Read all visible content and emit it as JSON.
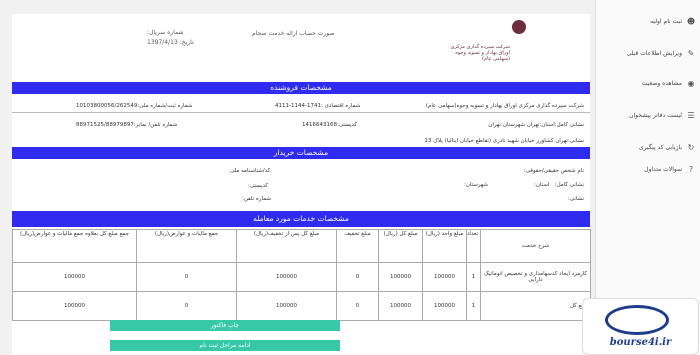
{
  "sidebar": {
    "items": [
      {
        "label": "ثبت نام اولیه",
        "icon": "user-icon"
      },
      {
        "label": "ویرایش اطلاعات قبلی",
        "icon": "edit-icon"
      },
      {
        "label": "مشاهده وضعیت",
        "icon": "eye-icon"
      },
      {
        "label": "لیست دفاتر پیشخوان",
        "icon": "list-icon"
      },
      {
        "label": "بازیابی کد پیگیری",
        "icon": "refresh-icon"
      },
      {
        "label": "سوالات متداول",
        "icon": "question-icon"
      }
    ]
  },
  "header": {
    "company_name": "شرکت سپرده گذاری مرکزی اوراق بهادار و تسویه وجوه (سهامی عام)",
    "invoice_title": "صورت حساب ارائه خدمت سجام",
    "serial_label": "شماره سریال:",
    "serial_value": "",
    "date_label": "تاریخ:",
    "date_value": "1397/4/13"
  },
  "seller": {
    "section_title": "مشخصات فروشنده",
    "name": "شرکت سپرده گذاری مرکزی اوراق بهادار و تسویه وجوه(سهامی عام)",
    "economic_no": "شماره اقتصادی :1741-1144-4111",
    "national_id": "شماره ثبت/شماره ملی:10103800056/262549",
    "full_address": "نشانی کامل:استان:تهران شهرستان:تهران",
    "postal_code": "کدپستی:1416643168",
    "phone": "شماره تلفن/ نمابر:88971525/88979897",
    "address": "نشانی:تهران کشاورز خیابان شهید نادری (تقاطع خیابان ایتالیا) پلاک 13"
  },
  "buyer": {
    "section_title": "مشخصات خریدار",
    "person_name": "نام شخص حقیقی/حقوقی:",
    "national_code": "کد/شناسنامه ملی",
    "full_address": "نشانی کامل:",
    "province": "استان:",
    "city": "شهرستان:",
    "postal_code": "کدپستی:",
    "address": "نشانی:",
    "phone": "شماره تلفن:"
  },
  "services": {
    "section_title": "مشخصات خدمات مورد معامله",
    "columns": [
      "شرح خدمت",
      "تعداد",
      "مبلغ واحد (ریال)",
      "مبلغ کل (ریال)",
      "مبلغ تخفیف",
      "مبلغ کل پس از تخفیف(ریال)",
      "جمع مالیات و عوارض(ریال)",
      "جمع مبلغ کل بعلاوه جمع مالیات و عوارض(ریال)"
    ],
    "rows": [
      [
        "کارمزد ایجاد کدسهامداری و تخصیص اتوماتیک دارایی",
        "1",
        "100000",
        "100000",
        "0",
        "100000",
        "0",
        "100000"
      ],
      [
        "جمع کل",
        "1",
        "100000",
        "100000",
        "0",
        "100000",
        "0",
        "100000"
      ]
    ]
  },
  "buttons": {
    "print": "چاپ فاکتور",
    "continue": "ادامه مراحل ثبت نام"
  },
  "watermark": {
    "text": "bourse4i.ir"
  }
}
